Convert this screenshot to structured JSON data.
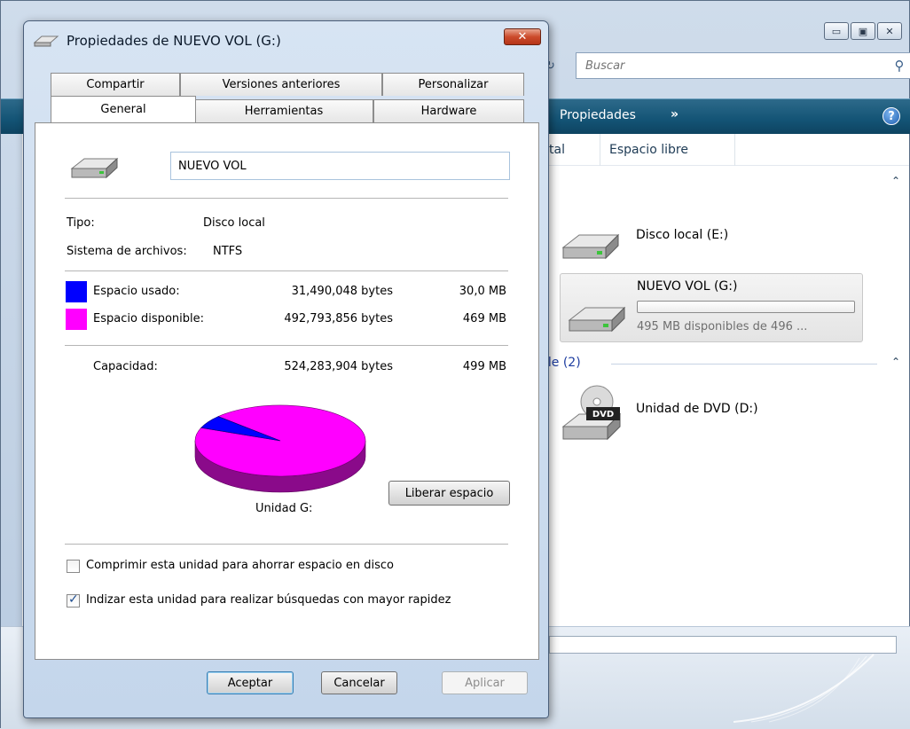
{
  "explorer": {
    "search_placeholder": "Buscar",
    "cmd_properties": "Propiedades",
    "cmd_more": "»",
    "columns": [
      "tal",
      "Espacio libre"
    ],
    "group_hdd_chevron": "⌃",
    "group_removable_label": "ble (2)",
    "drives": [
      {
        "label": "Disco local (E:)",
        "icon": "hard-drive-icon"
      },
      {
        "label": "NUEVO VOL (G:)",
        "icon": "hard-drive-icon",
        "free_text": "495 MB disponibles de 496 ...",
        "used_fraction": 0.0
      },
      {
        "label": "Unidad de DVD (D:)",
        "icon": "dvd-drive-icon",
        "badge": "DVD"
      }
    ]
  },
  "dialog": {
    "title": "Propiedades de NUEVO VOL (G:)",
    "close_label": "✕",
    "tabs_back": [
      "Compartir",
      "Versiones anteriores",
      "Personalizar"
    ],
    "tabs_front": [
      "General",
      "Herramientas",
      "Hardware"
    ],
    "active_tab": "General",
    "volume_name": "NUEVO VOL",
    "type_label": "Tipo:",
    "type_value": "Disco local",
    "fs_label": "Sistema de archivos:",
    "fs_value": "NTFS",
    "used_label": "Espacio usado:",
    "used_bytes": "31,490,048 bytes",
    "used_size": "30,0 MB",
    "free_label": "Espacio disponible:",
    "free_bytes": "492,793,856 bytes",
    "free_size": "469 MB",
    "capacity_label": "Capacidad:",
    "capacity_bytes": "524,283,904 bytes",
    "capacity_size": "499 MB",
    "drive_label": "Unidad G:",
    "cleanup_button": "Liberar espacio",
    "compress_label": "Comprimir esta unidad para ahorrar espacio en disco",
    "compress_checked": false,
    "index_label": "Indizar esta unidad para realizar búsquedas con mayor rapidez",
    "index_checked": true,
    "ok_button": "Aceptar",
    "cancel_button": "Cancelar",
    "apply_button": "Aplicar",
    "colors": {
      "used": "#0000FF",
      "free": "#FF00FF"
    },
    "used_fraction": 0.06
  }
}
